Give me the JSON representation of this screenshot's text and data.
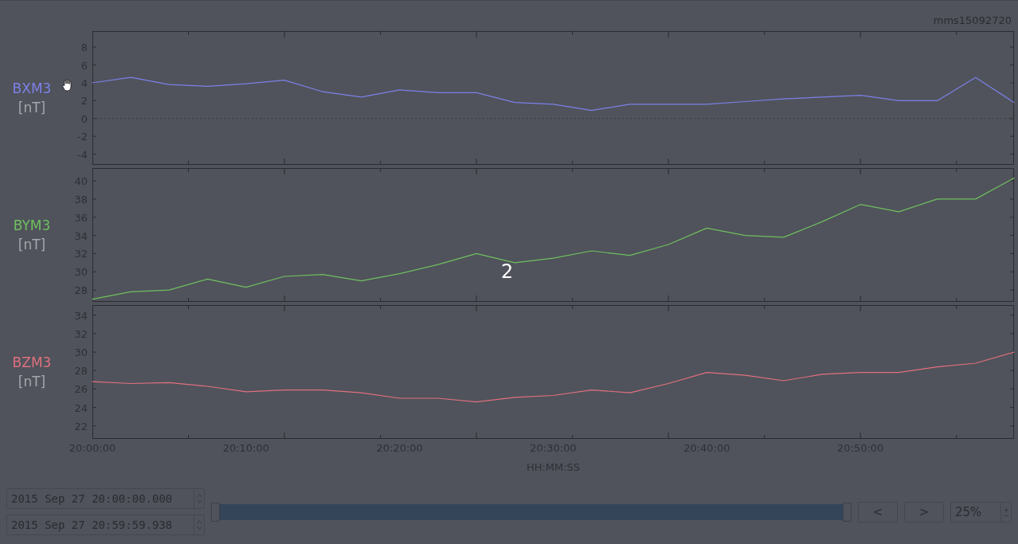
{
  "file_label": "mms15092720",
  "panels": [
    {
      "unit": "[nT]",
      "chart_data": {
        "type": "line",
        "categories": [
          null,
          null,
          null,
          null,
          null,
          null,
          null,
          null,
          null,
          null,
          null,
          null,
          null,
          null,
          null,
          null,
          null,
          null,
          null,
          null,
          null,
          null,
          null,
          null,
          null
        ],
        "ylim": [
          -5.2,
          9.8
        ],
        "yticks": [
          -4,
          -2,
          0,
          2,
          4,
          6,
          8
        ],
        "series": [
          {
            "name": "BXM3",
            "color": "#7d80e8",
            "values": [
              4.0,
              4.6,
              3.8,
              3.6,
              3.9,
              4.3,
              3.0,
              2.4,
              3.2,
              2.9,
              2.9,
              1.8,
              1.6,
              0.9,
              1.6,
              1.6,
              1.6,
              1.9,
              2.2,
              2.4,
              2.6,
              2.0,
              2.0,
              4.6,
              1.8
            ]
          }
        ]
      }
    },
    {
      "unit": "[nT]",
      "chart_data": {
        "type": "line",
        "categories": [
          null,
          null,
          null,
          null,
          null,
          null,
          null,
          null,
          null,
          null,
          null,
          null,
          null,
          null,
          null,
          null,
          null,
          null,
          null,
          null,
          null,
          null,
          null,
          null,
          null
        ],
        "ylim": [
          26.7,
          41.4
        ],
        "yticks": [
          28,
          30,
          32,
          34,
          36,
          38,
          40
        ],
        "series": [
          {
            "name": "BYM3",
            "color": "#6fbf5f",
            "values": [
              27.0,
              27.8,
              28.0,
              29.2,
              28.3,
              29.5,
              29.7,
              29.0,
              29.8,
              30.8,
              32.0,
              31.0,
              31.5,
              32.3,
              31.8,
              33.0,
              34.8,
              34.0,
              33.8,
              35.5,
              37.4,
              36.6,
              38.0,
              38.0,
              40.3
            ]
          }
        ]
      }
    },
    {
      "unit": "[nT]",
      "chart_data": {
        "type": "line",
        "categories": [
          "20:00:00",
          null,
          null,
          null,
          "20:10:00",
          null,
          null,
          null,
          "20:20:00",
          null,
          null,
          null,
          "20:30:00",
          null,
          null,
          null,
          "20:40:00",
          null,
          null,
          null,
          "20:50:00",
          null,
          null,
          null,
          null
        ],
        "ylim": [
          20.6,
          35.1
        ],
        "yticks": [
          22,
          24,
          26,
          28,
          30,
          32,
          34
        ],
        "xlabel": "HH:MM:SS",
        "series": [
          {
            "name": "BZM3",
            "color": "#e0707e",
            "values": [
              26.8,
              26.6,
              26.7,
              26.3,
              25.7,
              25.9,
              25.9,
              25.6,
              25.0,
              25.0,
              24.6,
              25.1,
              25.3,
              25.9,
              25.6,
              26.6,
              27.8,
              27.5,
              26.9,
              27.6,
              27.8,
              27.8,
              28.4,
              28.8,
              30.0
            ]
          }
        ]
      }
    }
  ],
  "overlay_number": "2",
  "start_time": "2015 Sep 27 20:00:00.000",
  "end_time": "2015 Sep 27 20:59:59.938",
  "range": {
    "level": 1
  },
  "buttons": [
    "<",
    ">"
  ],
  "zoom": {
    "value": "25%"
  }
}
